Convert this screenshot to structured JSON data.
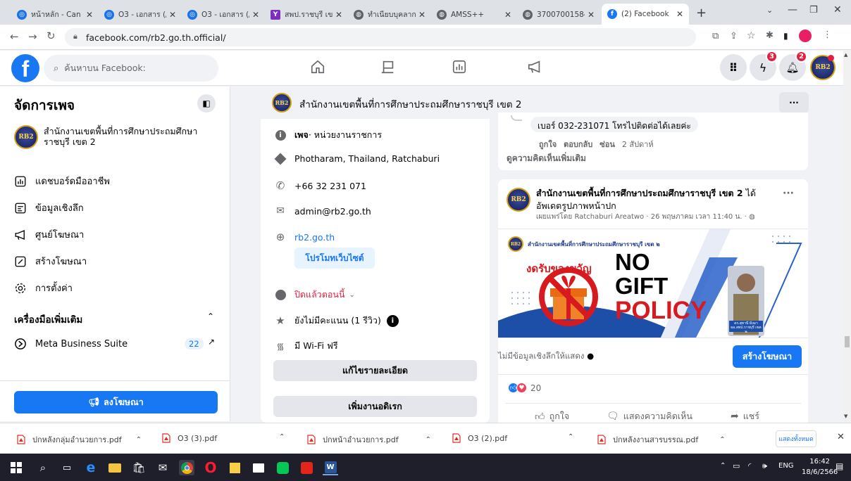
{
  "browser": {
    "tabs": [
      {
        "title": "หน้าหลัก - Can",
        "favicon_color": "#1a73e8"
      },
      {
        "title": "O3 - เอกสาร (/",
        "favicon_color": "#1a73e8"
      },
      {
        "title": "O3 - เอกสาร (/",
        "favicon_color": "#1a73e8"
      },
      {
        "title": "สพป.ราชบุรี เข",
        "favicon_color": "#7b2fbe"
      },
      {
        "title": "ทำเนียบบุคลาก",
        "favicon_color": "#5f6368"
      },
      {
        "title": "AMSS++",
        "favicon_color": "#5f6368"
      },
      {
        "title": "37007001584",
        "favicon_color": "#5f6368"
      },
      {
        "title": "(2) Facebook",
        "favicon_color": "#1877f2"
      }
    ],
    "url": "facebook.com/rb2.go.th.official/"
  },
  "fb": {
    "search_placeholder": "ค้นหาบน Facebook:",
    "messenger_badge": "3",
    "notif_badge": "2",
    "avatar_text": "RB2"
  },
  "sidebar": {
    "title": "จัดการเพจ",
    "page_name": "สำนักงานเขตพื้นที่การศึกษาประถมศึกษาราชบุรี เขต 2",
    "items": [
      {
        "label": "แดชบอร์ดมืออาชีพ"
      },
      {
        "label": "ข้อมูลเชิงลึก"
      },
      {
        "label": "ศูนย์โฆษณา"
      },
      {
        "label": "สร้างโฆษณา"
      },
      {
        "label": "การตั้งค่า"
      }
    ],
    "more_tools": "เครื่องมือเพิ่มเติม",
    "meta_suite": "Meta Business Suite",
    "meta_count": "22",
    "promote_btn": "ลงโฆษณา"
  },
  "pagebar": {
    "name": "สำนักงานเขตพื้นที่การศึกษาประถมศึกษาราชบุรี เขต 2",
    "more": "···"
  },
  "info": {
    "category_bold": "เพจ",
    "category_rest": " · หน่วยงานราชการ",
    "location": "Photharam, Thailand, Ratchaburi",
    "phone": "+66 32 231 071",
    "email": "admin@rb2.go.th",
    "website": "rb2.go.th",
    "promote_site": "โปรโมทเว็บไซต์",
    "hours": "ปิดแล้วตอนนี้",
    "rating": "ยังไม่มีคะแนน (1 รีวิว)",
    "wifi": "มี Wi-Fi ฟรี",
    "edit_btn": "แก้ไขรายละเอียด",
    "add_btn": "เพิ่มงานอดิเรก"
  },
  "comment": {
    "text": "เบอร์ 032-231071 โทรไปติดต่อได้เลยค่ะ",
    "like": "ถูกใจ",
    "reply": "ตอบกลับ",
    "hide": "ซ่อน",
    "time": "2 สัปดาห์",
    "more_comments": "ดูความคิดเห็นเพิ่มเติม"
  },
  "post": {
    "author": "สำนักงานเขตพื้นที่การศึกษาประถมศึกษาราชบุรี เขต 2",
    "author_suffix": " ได้",
    "action": "อัพเดตรูปภาพหน้าปก",
    "meta": "เผยแพร่โดย Ratchaburi Areatwo · 26 พฤษภาคม เวลา 11:40 น. ·",
    "banner_header": "สำนักงานเขตพื้นที่การศึกษาประถมศึกษาราชบุรี เขต ๒",
    "banner_red": "งดรับของขวัญ",
    "banner_no": "NO",
    "banner_gift": "GIFT",
    "banner_policy": "POLICY",
    "banner_caption": "ดร.สุทานี มิ่งมา ผอ.สพป.ราชบุรี เขต ๒",
    "insight_text": "ไม่มีข้อมูลเชิงลึกให้แสดง",
    "boost_btn": "สร้างโฆษณา",
    "reaction_count": "20",
    "like_btn": "ถูกใจ",
    "comment_btn": "แสดงความคิดเห็น",
    "share_btn": "แชร์"
  },
  "downloads": {
    "files": [
      "ปกหลังกลุ่มอำนวยการ.pdf",
      "O3 (3).pdf",
      "ปกหน้าอำนวยการ.pdf",
      "O3 (2).pdf",
      "ปกหลังงานสารบรรณ.pdf"
    ],
    "show_all": "แสดงทั้งหมด"
  },
  "taskbar": {
    "lang": "ENG",
    "time": "16:42",
    "date": "18/6/2566"
  }
}
